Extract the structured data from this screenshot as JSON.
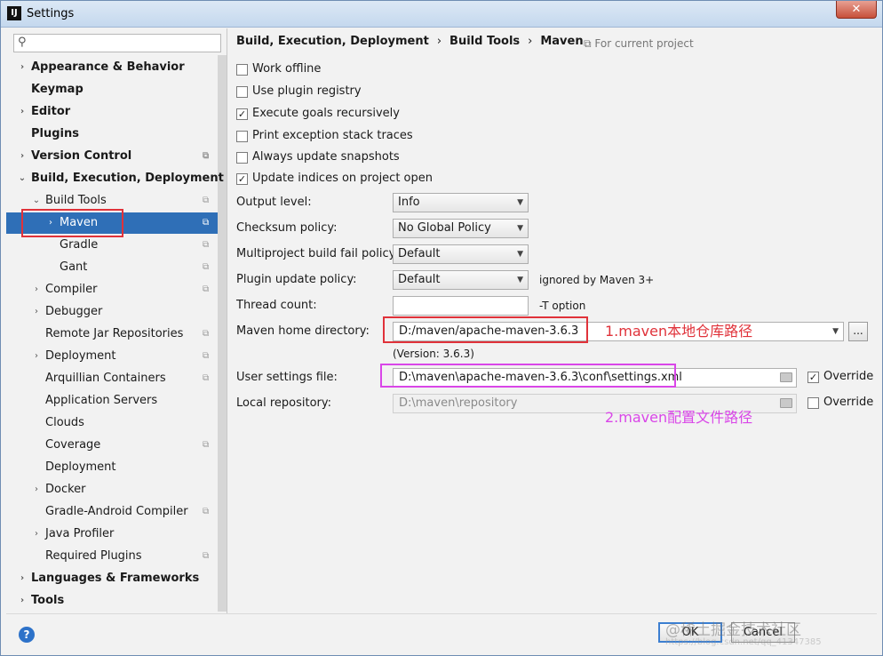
{
  "window": {
    "title": "Settings",
    "app_icon": "IJ",
    "close_glyph": "✕"
  },
  "sidebar": {
    "search_placeholder": "",
    "items": [
      {
        "label": "Appearance & Behavior",
        "arrow": "›"
      },
      {
        "label": "Keymap",
        "arrow": ""
      },
      {
        "label": "Editor",
        "arrow": "›"
      },
      {
        "label": "Plugins",
        "arrow": ""
      },
      {
        "label": "Version Control",
        "arrow": "›"
      },
      {
        "label": "Build, Execution, Deployment",
        "arrow": "⌄"
      },
      {
        "label": "Build Tools",
        "arrow": "⌄"
      },
      {
        "label": "Maven",
        "arrow": "›"
      },
      {
        "label": "Gradle",
        "arrow": ""
      },
      {
        "label": "Gant",
        "arrow": ""
      },
      {
        "label": "Compiler",
        "arrow": "›"
      },
      {
        "label": "Debugger",
        "arrow": "›"
      },
      {
        "label": "Remote Jar Repositories",
        "arrow": ""
      },
      {
        "label": "Deployment",
        "arrow": "›"
      },
      {
        "label": "Arquillian Containers",
        "arrow": ""
      },
      {
        "label": "Application Servers",
        "arrow": ""
      },
      {
        "label": "Clouds",
        "arrow": ""
      },
      {
        "label": "Coverage",
        "arrow": ""
      },
      {
        "label": "Deployment",
        "arrow": ""
      },
      {
        "label": "Docker",
        "arrow": "›"
      },
      {
        "label": "Gradle-Android Compiler",
        "arrow": ""
      },
      {
        "label": "Java Profiler",
        "arrow": "›"
      },
      {
        "label": "Required Plugins",
        "arrow": ""
      },
      {
        "label": "Languages & Frameworks",
        "arrow": "›"
      },
      {
        "label": "Tools",
        "arrow": "›"
      }
    ],
    "project_glyph": "⧉"
  },
  "main": {
    "breadcrumb": [
      "Build, Execution, Deployment",
      "Build Tools",
      "Maven"
    ],
    "breadcrumb_sep": "›",
    "for_current_project": "⧉ For current project",
    "checkboxes": [
      {
        "label": "Work offline",
        "checked": false
      },
      {
        "label": "Use plugin registry",
        "checked": false
      },
      {
        "label": "Execute goals recursively",
        "checked": true
      },
      {
        "label": "Print exception stack traces",
        "checked": false
      },
      {
        "label": "Always update snapshots",
        "checked": false
      },
      {
        "label": "Update indices on project open",
        "checked": true
      }
    ],
    "output_level": {
      "label": "Output level:",
      "value": "Info"
    },
    "checksum_policy": {
      "label": "Checksum policy:",
      "value": "No Global Policy"
    },
    "multiproject_fail_policy": {
      "label": "Multiproject build fail policy:",
      "value": "Default"
    },
    "plugin_update_policy": {
      "label": "Plugin update policy:",
      "value": "Default",
      "note": "ignored by Maven 3+"
    },
    "thread_count": {
      "label": "Thread count:",
      "value": "",
      "note": "-T option"
    },
    "maven_home": {
      "label": "Maven home directory:",
      "value": "D:/maven/apache-maven-3.6.3",
      "version": "(Version: 3.6.3)",
      "browse": "..."
    },
    "user_settings": {
      "label": "User settings file:",
      "value": "D:\\maven\\apache-maven-3.6.3\\conf\\settings.xml",
      "override_label": "Override",
      "override_checked": true
    },
    "local_repo": {
      "label": "Local repository:",
      "value": "D:\\maven\\repository",
      "override_label": "Override",
      "override_checked": false
    },
    "chevron_glyph": "▼",
    "check_glyph": "✓"
  },
  "annotations": {
    "maven_home_note": "1.maven本地仓库路径",
    "settings_note": "2.maven配置文件路径",
    "red": "#e0323a",
    "pink": "#d946e8"
  },
  "footer": {
    "help": "?",
    "ok": "OK",
    "cancel": "Cancel",
    "watermark": "@稀土掘金技术社区",
    "watermark_url": "https://blog.csdn.net/qq_41347385"
  }
}
